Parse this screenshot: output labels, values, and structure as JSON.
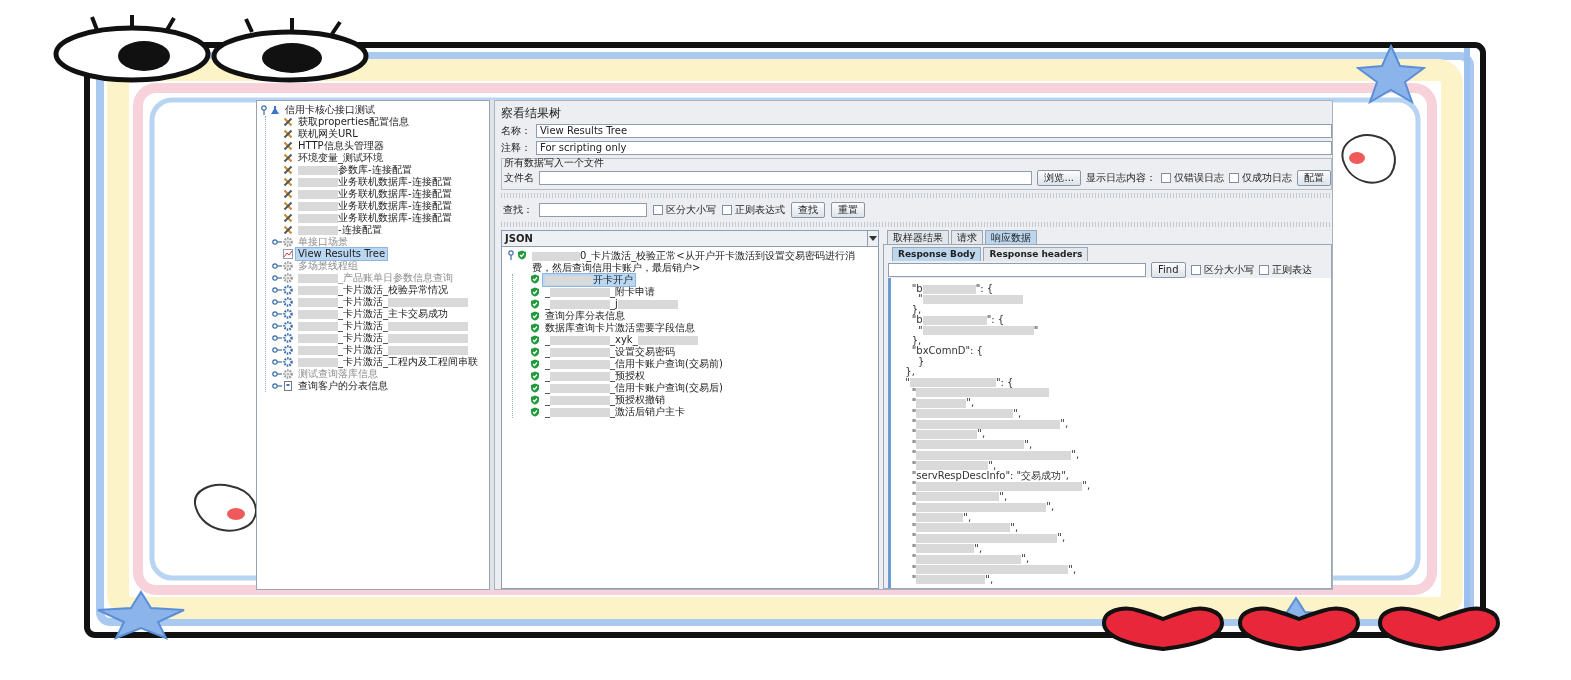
{
  "test_plan_tree": [
    {
      "kind": "test-plan",
      "segments": [
        "信用卡核心接口测试"
      ],
      "expanded": true,
      "selected": false,
      "disabled": false,
      "children": [
        {
          "kind": "config",
          "segments": [
            "获取properties配置信息"
          ],
          "selected": false,
          "disabled": false
        },
        {
          "kind": "config",
          "segments": [
            "联机网关URL"
          ],
          "selected": false,
          "disabled": false
        },
        {
          "kind": "config",
          "segments": [
            "HTTP信息头管理器"
          ],
          "selected": false,
          "disabled": false
        },
        {
          "kind": "config",
          "segments": [
            "环境变量_测试环境"
          ],
          "selected": false,
          "disabled": false
        },
        {
          "kind": "config",
          "segments": [
            {
              "kind": "blur"
            },
            "参数库-连接配置"
          ],
          "selected": false,
          "disabled": false
        },
        {
          "kind": "config",
          "segments": [
            {
              "kind": "blur"
            },
            "业务联机数据库-连接配置"
          ],
          "selected": false,
          "disabled": false
        },
        {
          "kind": "config",
          "segments": [
            {
              "kind": "blur"
            },
            "业务联机数据库-连接配置"
          ],
          "selected": false,
          "disabled": false
        },
        {
          "kind": "config",
          "segments": [
            {
              "kind": "blur"
            },
            "业务联机数据库-连接配置"
          ],
          "selected": false,
          "disabled": false
        },
        {
          "kind": "config",
          "segments": [
            {
              "kind": "blur"
            },
            "业务联机数据库-连接配置"
          ],
          "selected": false,
          "disabled": false
        },
        {
          "kind": "config",
          "segments": [
            {
              "kind": "blur"
            },
            "-连接配置"
          ],
          "selected": false,
          "disabled": false
        },
        {
          "kind": "thread-group",
          "segments": [
            "单接口场景"
          ],
          "expanded": false,
          "selected": false,
          "disabled": true
        },
        {
          "kind": "listener",
          "segments": [
            "View Results Tree"
          ],
          "selected": true,
          "disabled": false
        },
        {
          "kind": "thread-group",
          "segments": [
            "多场景线程组"
          ],
          "expanded": false,
          "selected": false,
          "disabled": true
        },
        {
          "kind": "thread-group",
          "segments": [
            {
              "kind": "blur"
            },
            "_产品账单日参数信息查询"
          ],
          "expanded": false,
          "selected": false,
          "disabled": true
        },
        {
          "kind": "thread-group",
          "segments": [
            {
              "kind": "blur"
            },
            "_卡片激活_校验异常情况"
          ],
          "expanded": false,
          "selected": false,
          "disabled": false
        },
        {
          "kind": "thread-group",
          "segments": [
            {
              "kind": "blur"
            },
            "_卡片激活_",
            {
              "kind": "blur"
            }
          ],
          "expanded": false,
          "selected": false,
          "disabled": false
        },
        {
          "kind": "thread-group",
          "segments": [
            {
              "kind": "blur"
            },
            "_卡片激活_主卡交易成功"
          ],
          "expanded": false,
          "selected": false,
          "disabled": false
        },
        {
          "kind": "thread-group",
          "segments": [
            {
              "kind": "blur"
            },
            "_卡片激活_",
            {
              "kind": "blur"
            }
          ],
          "expanded": false,
          "selected": false,
          "disabled": false
        },
        {
          "kind": "thread-group",
          "segments": [
            {
              "kind": "blur"
            },
            "_卡片激活_",
            {
              "kind": "blur"
            }
          ],
          "expanded": false,
          "selected": false,
          "disabled": false
        },
        {
          "kind": "thread-group",
          "segments": [
            {
              "kind": "blur"
            },
            "_卡片激活_",
            {
              "kind": "blur"
            }
          ],
          "expanded": false,
          "selected": false,
          "disabled": false
        },
        {
          "kind": "thread-group",
          "segments": [
            {
              "kind": "blur"
            },
            "_卡片激活_工程内及工程间串联"
          ],
          "expanded": false,
          "selected": false,
          "disabled": false
        },
        {
          "kind": "thread-group",
          "segments": [
            "测试查询落库信息"
          ],
          "expanded": false,
          "selected": false,
          "disabled": true
        },
        {
          "kind": "controller",
          "segments": [
            "查询客户的分表信息"
          ],
          "expanded": false,
          "selected": false,
          "disabled": false
        }
      ]
    }
  ],
  "results_panel": {
    "title": "察看结果树",
    "name_field": {
      "label": "名称：",
      "value": "View Results Tree"
    },
    "comment_field": {
      "label": "注释：",
      "value": "For scripting only"
    },
    "file_group": {
      "title": "所有数据写入一个文件",
      "file_label": "文件名",
      "browse_button": "浏览...",
      "log_label": "显示日志内容：",
      "checkboxes": [
        {
          "label": "仅错误日志",
          "checked": false
        },
        {
          "label": "仅成功日志",
          "checked": false
        }
      ],
      "config_button": "配置"
    },
    "search": {
      "label": "查找：",
      "checkboxes": [
        {
          "label": "区分大小写",
          "checked": false
        },
        {
          "label": "正则表达式",
          "checked": false
        }
      ],
      "buttons": [
        "查找",
        "重置"
      ]
    },
    "renderer": "JSON",
    "results": [
      {
        "passed": true,
        "segments": [
          {
            "kind": "blur"
          },
          "0_卡片激活_校验正常<从开户开卡激活到设置交易密码进行消费，然后查询信用卡账户，最后销户>"
        ],
        "expanded": true,
        "selected": false,
        "children": [
          {
            "passed": true,
            "segments": [
              {
                "kind": "blur"
              },
              "开卡开户"
            ],
            "selected": true
          },
          {
            "passed": true,
            "segments": [
              "_",
              {
                "kind": "blur"
              },
              "_附卡申请"
            ],
            "selected": false
          },
          {
            "passed": true,
            "segments": [
              "_",
              {
                "kind": "blur"
              },
              "_j",
              {
                "kind": "blur"
              }
            ],
            "selected": false
          },
          {
            "passed": true,
            "segments": [
              "查询分库分表信息"
            ],
            "selected": false
          },
          {
            "passed": true,
            "segments": [
              "数据库查询卡片激活需要字段信息"
            ],
            "selected": false
          },
          {
            "passed": true,
            "segments": [
              "_",
              {
                "kind": "blur"
              },
              "_xyk_",
              {
                "kind": "blur"
              }
            ],
            "selected": false
          },
          {
            "passed": true,
            "segments": [
              "_",
              {
                "kind": "blur"
              },
              "_设置交易密码"
            ],
            "selected": false
          },
          {
            "passed": true,
            "segments": [
              "_",
              {
                "kind": "blur"
              },
              "_信用卡账户查询(交易前)"
            ],
            "selected": false
          },
          {
            "passed": true,
            "segments": [
              "_",
              {
                "kind": "blur"
              },
              "_预授权"
            ],
            "selected": false
          },
          {
            "passed": true,
            "segments": [
              "_",
              {
                "kind": "blur"
              },
              "_信用卡账户查询(交易后)"
            ],
            "selected": false
          },
          {
            "passed": true,
            "segments": [
              "_",
              {
                "kind": "blur"
              },
              "_预授权撤销"
            ],
            "selected": false
          },
          {
            "passed": true,
            "segments": [
              "_",
              {
                "kind": "blur"
              },
              "_激活后销户主卡"
            ],
            "selected": false
          }
        ]
      }
    ],
    "tabs": [
      {
        "label": "取样器结果",
        "selected": false
      },
      {
        "label": "请求",
        "selected": false
      },
      {
        "label": "响应数据",
        "selected": true
      }
    ],
    "body_tabs": [
      {
        "label": "Response Body",
        "selected": true
      },
      {
        "label": "Response headers",
        "selected": false
      }
    ],
    "find": {
      "button": "Find",
      "checkboxes": [
        {
          "label": "区分大小写",
          "checked": false
        },
        {
          "label": "正则表达",
          "checked": false
        }
      ]
    },
    "lines": [
      [
        "    \"b",
        {
          "kind": "blur"
        },
        "\": {"
      ],
      [
        "      \"",
        {
          "kind": "blur"
        }
      ],
      [
        "    },"
      ],
      [
        "    \"b",
        {
          "kind": "blur"
        },
        "\": {"
      ],
      [
        "      \"",
        {
          "kind": "blur"
        },
        "\""
      ],
      [
        "    },"
      ],
      [
        "    \"bxComnD\": {"
      ],
      [
        "      }"
      ],
      [
        "  },"
      ],
      [
        "  \"",
        {
          "kind": "blur"
        },
        "\": {"
      ],
      [
        "    \"",
        {
          "kind": "blur"
        }
      ],
      [
        "    \"",
        {
          "kind": "blur"
        },
        "\","
      ],
      [
        "    \"",
        {
          "kind": "blur"
        },
        "\","
      ],
      [
        "    \"",
        {
          "kind": "blur"
        },
        "\","
      ],
      [
        "    \"",
        {
          "kind": "blur"
        },
        "\","
      ],
      [
        "    \"",
        {
          "kind": "blur"
        },
        "\","
      ],
      [
        "    \"",
        {
          "kind": "blur"
        },
        "\","
      ],
      [
        "    \"",
        {
          "kind": "blur"
        },
        "\","
      ],
      [
        "    \"servRespDescInfo\": \"交易成功\","
      ],
      [
        "    \"",
        {
          "kind": "blur"
        },
        "\","
      ],
      [
        "    \"",
        {
          "kind": "blur"
        },
        "\","
      ],
      [
        "    \"",
        {
          "kind": "blur"
        },
        "\","
      ],
      [
        "    \"",
        {
          "kind": "blur"
        },
        "\","
      ],
      [
        "    \"",
        {
          "kind": "blur"
        },
        "\","
      ],
      [
        "    \"",
        {
          "kind": "blur"
        },
        "\","
      ],
      [
        "    \"",
        {
          "kind": "blur"
        },
        "\","
      ],
      [
        "    \"",
        {
          "kind": "blur"
        },
        "\","
      ],
      [
        "    \"",
        {
          "kind": "blur"
        },
        "\","
      ],
      [
        "    \"",
        {
          "kind": "blur"
        },
        "\","
      ]
    ]
  }
}
